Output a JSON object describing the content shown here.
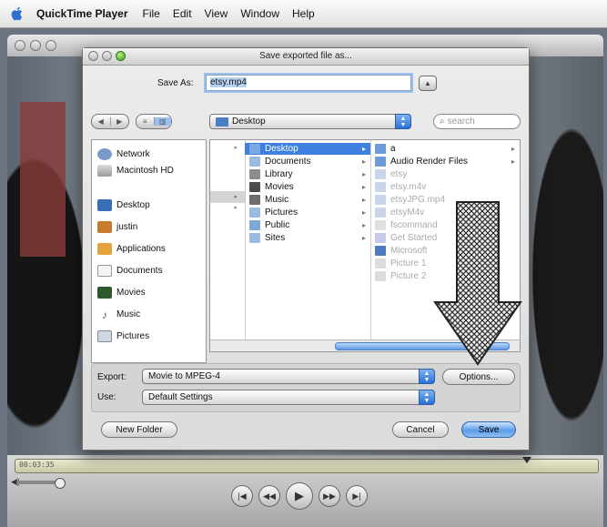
{
  "menubar": {
    "app": "QuickTime Player",
    "items": [
      "File",
      "Edit",
      "View",
      "Window",
      "Help"
    ]
  },
  "player": {
    "timecode": "00:03:35"
  },
  "sheet": {
    "title": "Save exported file as...",
    "save_as_label": "Save As:",
    "filename": "etsy.mp4",
    "location": "Desktop",
    "search_placeholder": "search",
    "sidebar": {
      "devices": [
        "Network",
        "Macintosh HD"
      ],
      "places": [
        "Desktop",
        "justin",
        "Applications",
        "Documents",
        "Movies",
        "Music",
        "Pictures"
      ]
    },
    "columns": {
      "col2": [
        "Desktop",
        "Documents",
        "Library",
        "Movies",
        "Music",
        "Pictures",
        "Public",
        "Sites"
      ],
      "col3": [
        "a",
        "Audio Render Files",
        "etsy",
        "etsy.m4v",
        "etsyJPG.mp4",
        "etsyM4v",
        "fscommand",
        "Get Started",
        "Microsoft",
        "Picture 1",
        "Picture 2"
      ]
    },
    "export_label": "Export:",
    "export_value": "Movie to MPEG-4",
    "options_button": "Options...",
    "use_label": "Use:",
    "use_value": "Default Settings",
    "new_folder_button": "New Folder",
    "cancel_button": "Cancel",
    "save_button": "Save"
  },
  "colors": {
    "selection": "#3d80df",
    "aqua_button": "#5c9ce8"
  }
}
